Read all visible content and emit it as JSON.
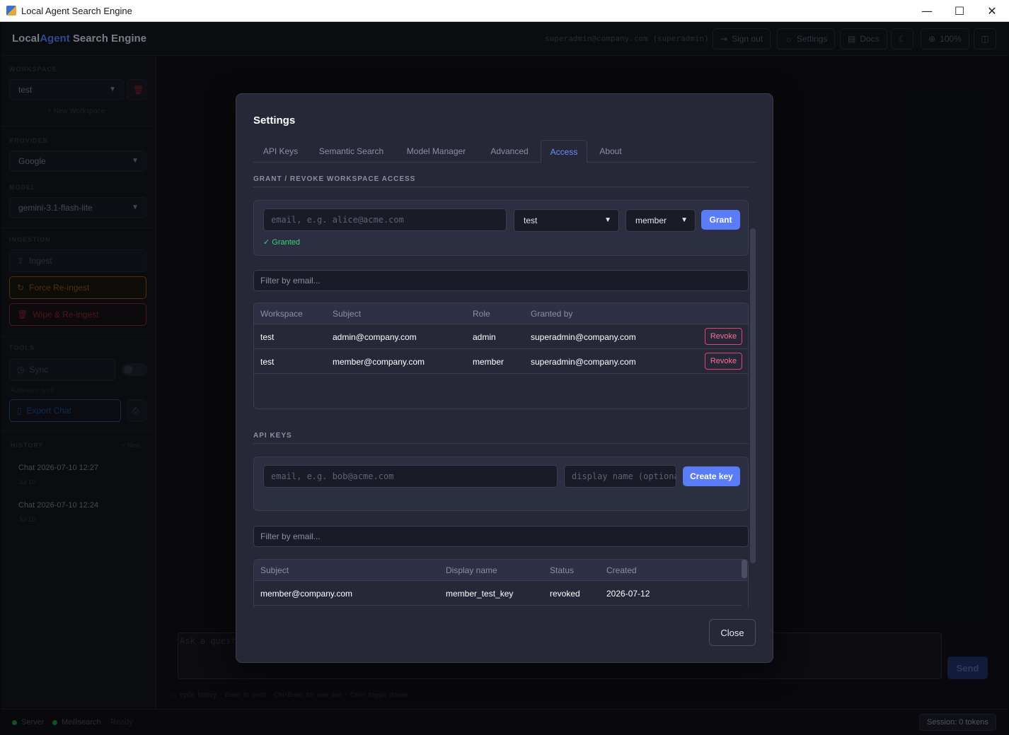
{
  "window": {
    "title": "Local Agent Search Engine",
    "minimize": "—",
    "maximize": "☐",
    "close": "✕"
  },
  "header": {
    "brand_local": "Local",
    "brand_agent": "Agent",
    "brand_rest": " Search Engine",
    "user": "superadmin@company.com (superadmin)",
    "signout": "Sign out",
    "settings": "Settings",
    "docs": "Docs",
    "zoom": "100%"
  },
  "sidebar": {
    "workspace_label": "WORKSPACE",
    "workspace_value": "test",
    "new_workspace": "+ New Workspace",
    "provider_label": "PROVIDER",
    "provider_value": "Google",
    "model_label": "MODEL",
    "model_value": "gemini-3.1-flash-lite",
    "ingestion_label": "INGESTION",
    "ingest": "Ingest",
    "force_reingest": "Force Re-ingest",
    "wipe_reingest": "Wipe & Re-ingest",
    "tools_label": "TOOLS",
    "sync": "Sync",
    "autosync": "Auto-sync is off",
    "export_chat": "Export Chat",
    "history_label": "HISTORY",
    "history_new": "+ New",
    "history": [
      {
        "title": "Chat 2026-07-10 12:27",
        "date": "Jul 10"
      },
      {
        "title": "Chat 2026-07-10 12:24",
        "date": "Jul 10"
      }
    ]
  },
  "chat": {
    "placeholder": "Ask a question…",
    "send": "Send",
    "hints": "↑↓ cycle history · Enter to send · Ctrl+Enter for new line · Ctrl+/ toggle drawer"
  },
  "status": {
    "server": "Server",
    "meili": "Meilisearch",
    "ready": "Ready",
    "session": "Session: 0 tokens"
  },
  "modal": {
    "title": "Settings",
    "tabs": [
      "API Keys",
      "Semantic Search",
      "Model Manager",
      "Advanced",
      "Access",
      "About"
    ],
    "active_tab": "Access",
    "grant_section": "GRANT / REVOKE WORKSPACE ACCESS",
    "grant_email_placeholder": "email, e.g. alice@acme.com",
    "grant_workspace": "test",
    "grant_role": "member",
    "grant_button": "Grant",
    "granted_msg": "✓ Granted",
    "filter_placeholder": "Filter by email...",
    "access_columns": [
      "Workspace",
      "Subject",
      "Role",
      "Granted by"
    ],
    "access_rows": [
      {
        "workspace": "test",
        "subject": "admin@company.com",
        "role": "admin",
        "granted_by": "superadmin@company.com",
        "action": "Revoke"
      },
      {
        "workspace": "test",
        "subject": "member@company.com",
        "role": "member",
        "granted_by": "superadmin@company.com",
        "action": "Revoke"
      }
    ],
    "apikeys_section": "API KEYS",
    "key_email_placeholder": "email, e.g. bob@acme.com",
    "key_name_placeholder": "display name (optional)",
    "create_key": "Create key",
    "key_filter_placeholder": "Filter by email...",
    "key_columns": [
      "Subject",
      "Display name",
      "Status",
      "Created"
    ],
    "key_rows": [
      {
        "subject": "member@company.com",
        "display_name": "member_test_key",
        "status": "revoked",
        "created": "2026-07-12"
      }
    ],
    "close": "Close"
  }
}
